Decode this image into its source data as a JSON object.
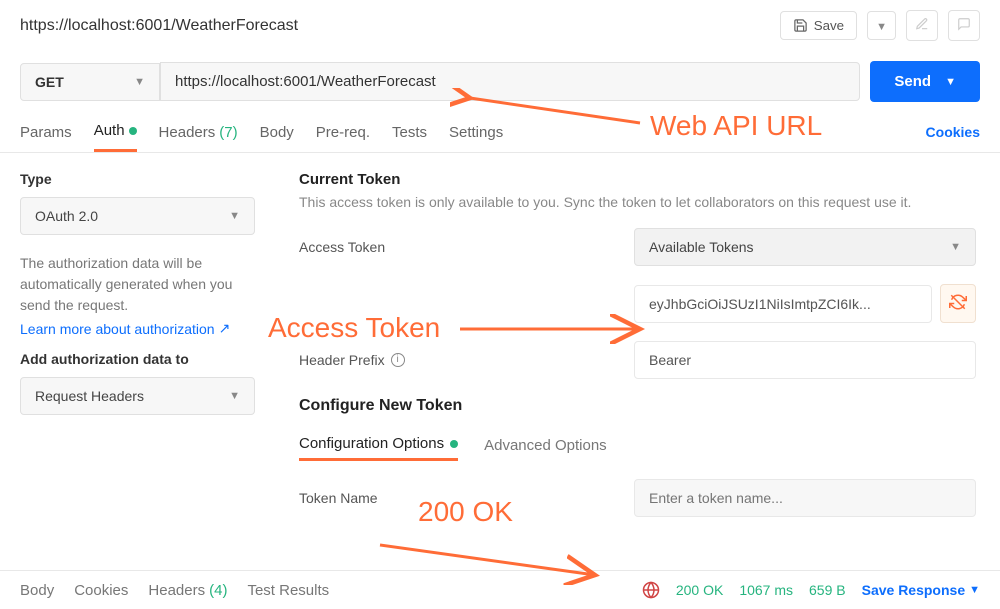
{
  "header": {
    "title": "https://localhost:6001/WeatherForecast",
    "save": "Save"
  },
  "request": {
    "method": "GET",
    "url": "https://localhost:6001/WeatherForecast",
    "send": "Send"
  },
  "tabs": {
    "params": "Params",
    "auth": "Auth",
    "headers": "Headers",
    "headers_count": "(7)",
    "body": "Body",
    "prereq": "Pre-req.",
    "tests": "Tests",
    "settings": "Settings",
    "cookies": "Cookies"
  },
  "auth": {
    "type_label": "Type",
    "type_value": "OAuth 2.0",
    "desc": "The authorization data will be automatically generated when you send the request.",
    "learn_link": "Learn more about authorization",
    "add_to_label": "Add authorization data to",
    "add_to_value": "Request Headers",
    "current_title": "Current Token",
    "current_desc": "This access token is only available to you. Sync the token to let collaborators on this request use it.",
    "access_token_label": "Access Token",
    "available_tokens": "Available Tokens",
    "token_value": "eyJhbGciOiJSUzI1NiIsImtpZCI6Ik...",
    "header_prefix_label": "Header Prefix",
    "header_prefix_value": "Bearer",
    "config_title": "Configure New Token",
    "config_tab": "Configuration Options",
    "advanced_tab": "Advanced Options",
    "token_name_label": "Token Name",
    "token_name_placeholder": "Enter a token name..."
  },
  "response": {
    "body": "Body",
    "cookies": "Cookies",
    "headers": "Headers",
    "headers_count": "(4)",
    "tests": "Test Results",
    "status": "200 OK",
    "time": "1067 ms",
    "size": "659 B",
    "save": "Save Response"
  },
  "annotations": {
    "url": "Web API URL",
    "token": "Access Token",
    "ok": "200 OK"
  }
}
